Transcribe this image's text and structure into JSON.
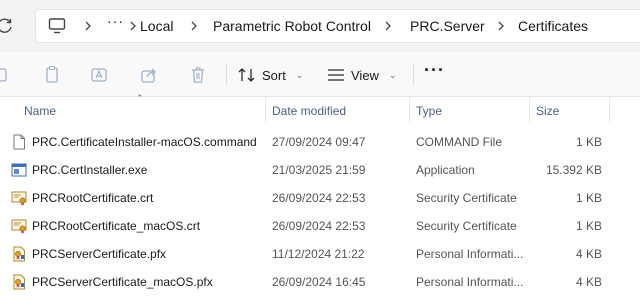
{
  "address_bar": {
    "overflow_label": "···",
    "breadcrumbs": [
      "Local",
      "Parametric Robot Control",
      "PRC.Server",
      "Certificates"
    ]
  },
  "toolbar": {
    "sort_label": "Sort",
    "view_label": "View",
    "more_label": "···"
  },
  "columns": {
    "name": "Name",
    "date_modified": "Date modified",
    "type": "Type",
    "size": "Size"
  },
  "files": [
    {
      "name": "PRC.CertificateInstaller-macOS.command",
      "date": "27/09/2024 09:47",
      "type": "COMMAND File",
      "size": "1 KB",
      "icon": "blank-file-icon"
    },
    {
      "name": "PRC.CertInstaller.exe",
      "date": "21/03/2025 21:59",
      "type": "Application",
      "size": "15.392 KB",
      "icon": "application-icon"
    },
    {
      "name": "PRCRootCertificate.crt",
      "date": "26/09/2024 22:53",
      "type": "Security Certificate",
      "size": "1 KB",
      "icon": "certificate-icon"
    },
    {
      "name": "PRCRootCertificate_macOS.crt",
      "date": "26/09/2024 22:53",
      "type": "Security Certificate",
      "size": "1 KB",
      "icon": "certificate-icon"
    },
    {
      "name": "PRCServerCertificate.pfx",
      "date": "11/12/2024 21:22",
      "type": "Personal Informati...",
      "size": "4 KB",
      "icon": "personal-info-icon"
    },
    {
      "name": "PRCServerCertificate_macOS.pfx",
      "date": "26/09/2024 16:45",
      "type": "Personal Informati...",
      "size": "4 KB",
      "icon": "personal-info-icon"
    }
  ]
}
